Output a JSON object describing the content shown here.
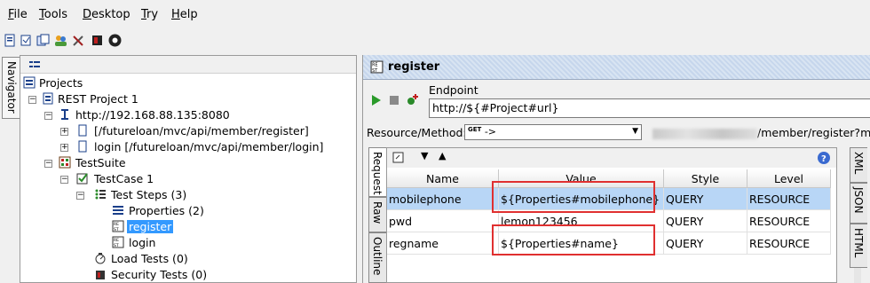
{
  "menu": [
    {
      "key": "F",
      "rest": "ile"
    },
    {
      "key": "T",
      "rest": "ools"
    },
    {
      "key": "D",
      "rest": "esktop"
    },
    {
      "key": "T",
      "rest": "ry"
    },
    {
      "key": "H",
      "rest": "elp"
    }
  ],
  "navigator_tab": "Navigator",
  "tree": {
    "projects": "Projects",
    "rest_project": "REST Project 1",
    "host": "http://192.168.88.135:8080",
    "resource_register": "[/futureloan/mvc/api/member/register]",
    "resource_login": "login [/futureloan/mvc/api/member/login]",
    "testsuite": "TestSuite",
    "testcase": "TestCase 1",
    "test_steps": "Test Steps (3)",
    "properties": "Properties (2)",
    "register": "register",
    "login": "login",
    "load_tests": "Load Tests (0)",
    "security_tests": "Security Tests (0)"
  },
  "right": {
    "title": "register",
    "endpoint_label": "Endpoint",
    "endpoint_value": "http://${#Project#url}",
    "resource_method_label": "Resource/Method:",
    "method_badge": "GET",
    "method_value": "->",
    "resource_path": "/member/register?mo"
  },
  "request_tabs": [
    "Request",
    "Raw",
    "Outline"
  ],
  "right_tabs": [
    "XML",
    "JSON",
    "HTML"
  ],
  "table": {
    "headers": [
      "Name",
      "Value",
      "Style",
      "Level"
    ],
    "rows": [
      {
        "name": "mobilephone",
        "value": "${Properties#mobilephone}",
        "style": "QUERY",
        "level": "RESOURCE"
      },
      {
        "name": "pwd",
        "value": "lemon123456",
        "style": "QUERY",
        "level": "RESOURCE"
      },
      {
        "name": "regname",
        "value": "${Properties#name}",
        "style": "QUERY",
        "level": "RESOURCE"
      }
    ]
  },
  "colors": {
    "selection": "#3399ff",
    "row_selected": "#b8d6f6",
    "highlight_box": "#e03030"
  }
}
